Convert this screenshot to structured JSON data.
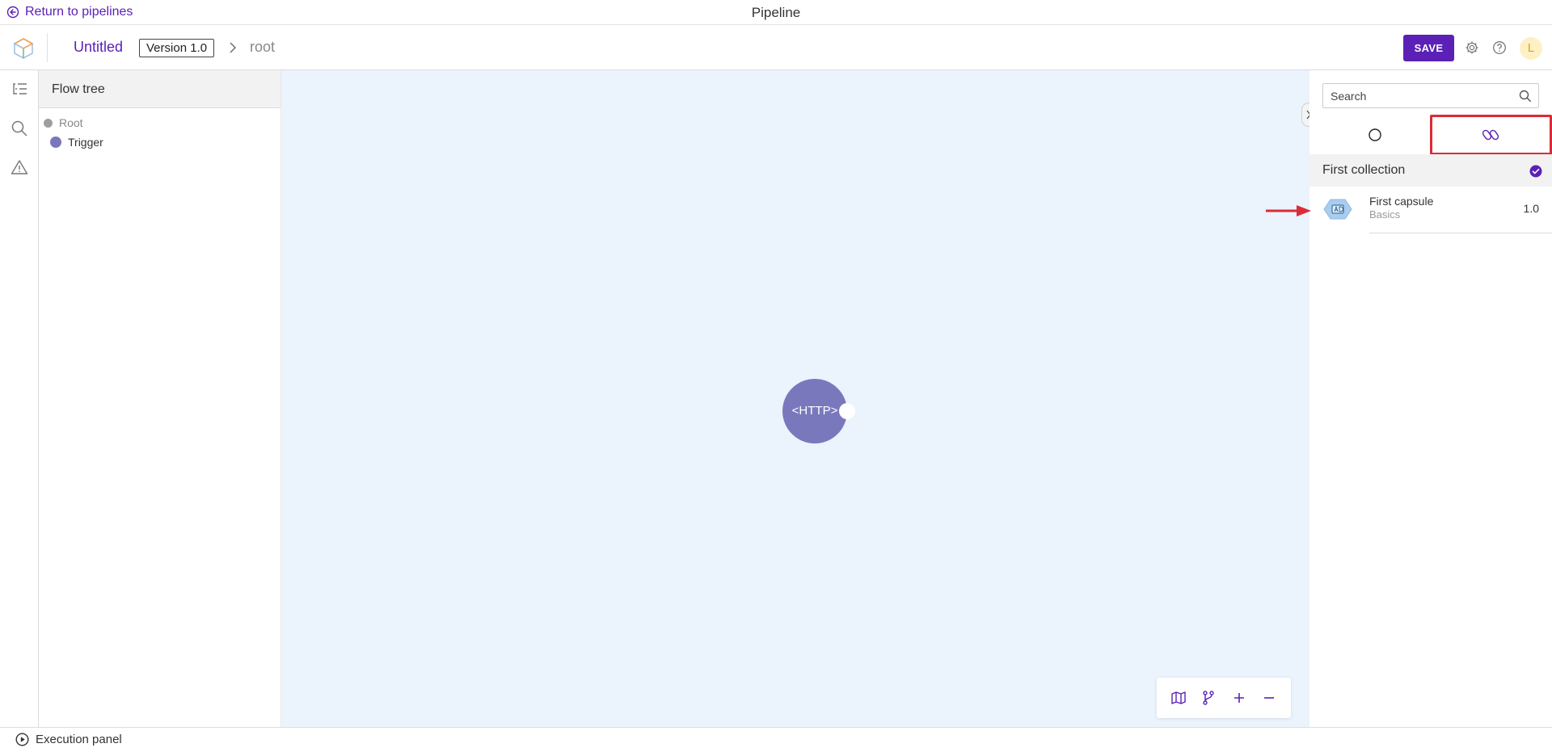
{
  "topbar": {
    "back_label": "Return to pipelines",
    "page_title": "Pipeline"
  },
  "header": {
    "pipeline_name": "Untitled",
    "version": "Version 1.0",
    "breadcrumb_current": "root",
    "save_label": "SAVE",
    "avatar_initial": "L",
    "icons": [
      "settings-icon",
      "help-icon"
    ]
  },
  "rail": {
    "items": [
      "flow-tree-icon",
      "search-icon",
      "warning-icon"
    ]
  },
  "flow_tree": {
    "title": "Flow tree",
    "nodes": [
      {
        "label": "Root",
        "color": "#9e9e9e"
      },
      {
        "label": "Trigger",
        "color": "#7a78bd"
      }
    ]
  },
  "canvas": {
    "background": "#ebf3fc",
    "node_label": "<HTTP>",
    "node_color": "#7a78bd",
    "controls": [
      "map-icon",
      "branch-icon",
      "zoom-in-icon",
      "zoom-out-icon"
    ]
  },
  "right_panel": {
    "search_placeholder": "Search",
    "tabs": [
      {
        "icon": "circle-icon",
        "active": false
      },
      {
        "icon": "capsules-icon",
        "active": true
      }
    ],
    "collection": {
      "name": "First collection",
      "items": [
        {
          "name": "First capsule",
          "subtitle": "Basics",
          "version": "1.0"
        }
      ]
    }
  },
  "footer": {
    "execution_label": "Execution panel"
  },
  "colors": {
    "accent": "#5b21b6",
    "highlight": "#dc2b37",
    "canvas": "#ebf3fc",
    "node": "#7a78bd"
  }
}
